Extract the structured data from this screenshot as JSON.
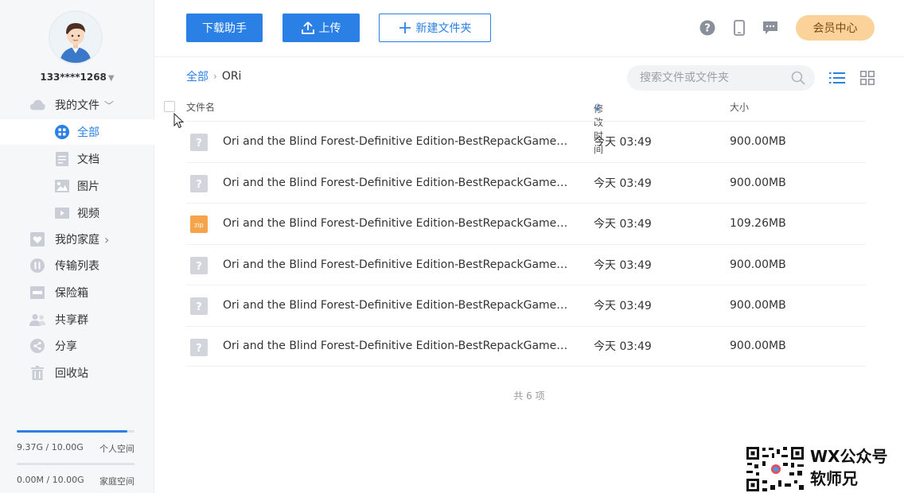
{
  "sidebar": {
    "account": "133****1268",
    "nav": [
      {
        "label": "我的文件",
        "arrow": "﹀"
      },
      {
        "label": "全部"
      },
      {
        "label": "文档"
      },
      {
        "label": "图片"
      },
      {
        "label": "视频"
      },
      {
        "label": "我的家庭",
        "arrow": "›"
      },
      {
        "label": "传输列表"
      },
      {
        "label": "保险箱"
      },
      {
        "label": "共享群"
      },
      {
        "label": "分享"
      },
      {
        "label": "回收站"
      }
    ],
    "storage": [
      {
        "used": "9.37G / 10.00G",
        "label": "个人空间",
        "fill": 0.937
      },
      {
        "used": "0.00M / 10.00G",
        "label": "家庭空间",
        "fill": 0
      }
    ]
  },
  "toolbar": {
    "download_helper": "下载助手",
    "upload": "上传",
    "new_folder": "新建文件夹",
    "vip_center": "会员中心"
  },
  "breadcrumb": {
    "root": "全部",
    "sep": "›",
    "current": "ORi"
  },
  "search": {
    "placeholder": "搜索文件或文件夹"
  },
  "table": {
    "headers": {
      "name": "文件名",
      "modified": "修改时间",
      "sort_arrow": "↓",
      "size": "大小"
    },
    "rows": [
      {
        "name": "Ori and the Blind Forest-Definitive Edition-BestRepackGames.com (…",
        "date": "今天  03:49",
        "size": "900.00MB",
        "icon": "unknown-file-icon"
      },
      {
        "name": "Ori and the Blind Forest-Definitive Edition-BestRepackGames.com (…",
        "date": "今天  03:49",
        "size": "900.00MB",
        "icon": "unknown-file-icon"
      },
      {
        "name": "Ori and the Blind Forest-Definitive Edition-BestRepackGames.com (…",
        "date": "今天  03:49",
        "size": "109.26MB",
        "icon": "zip-file-icon"
      },
      {
        "name": "Ori and the Blind Forest-Definitive Edition-BestRepackGames.com (…",
        "date": "今天  03:49",
        "size": "900.00MB",
        "icon": "unknown-file-icon"
      },
      {
        "name": "Ori and the Blind Forest-Definitive Edition-BestRepackGames.com (…",
        "date": "今天  03:49",
        "size": "900.00MB",
        "icon": "unknown-file-icon"
      },
      {
        "name": "Ori and the Blind Forest-Definitive Edition-BestRepackGames.com (…",
        "date": "今天  03:49",
        "size": "900.00MB",
        "icon": "unknown-file-icon"
      }
    ],
    "total": "共 6 项"
  },
  "watermark": {
    "line1": "WX公众号",
    "line2": "软师兄"
  },
  "colors": {
    "accent": "#2b80e6",
    "vip_bg": "#fbd39a",
    "zip": "#f5a44c"
  }
}
